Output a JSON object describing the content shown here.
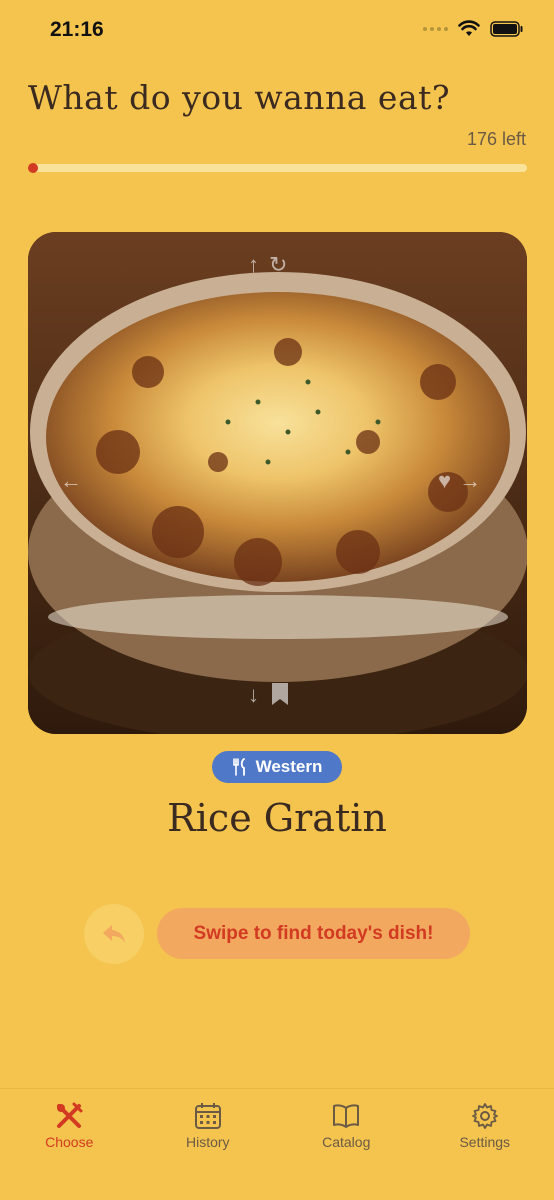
{
  "status_bar": {
    "time": "21:16"
  },
  "header": {
    "title": "What do you wanna eat?",
    "remaining": "176 left",
    "progress": 0.01
  },
  "card": {
    "dish_image_alt": "Rice Gratin",
    "hint_icons": [
      "arrow-up-icon",
      "refresh-icon",
      "arrow-left-icon",
      "heart-icon",
      "arrow-right-icon",
      "arrow-down-icon",
      "bookmark-icon"
    ]
  },
  "dish": {
    "cuisine_tag": "Western",
    "name": "Rice Gratin"
  },
  "actions": {
    "cta_label": "Swipe to find today's dish!"
  },
  "tab_bar": {
    "tabs": [
      {
        "label": "Choose",
        "icon": "utensils-cross-icon",
        "active": true
      },
      {
        "label": "History",
        "icon": "calendar-icon",
        "active": false
      },
      {
        "label": "Catalog",
        "icon": "book-icon",
        "active": false
      },
      {
        "label": "Settings",
        "icon": "gear-icon",
        "active": false
      }
    ]
  },
  "colors": {
    "background": "#f4c44f",
    "accent": "#d23a22",
    "tag": "#4f78c8",
    "cta_bg": "#f2a85f"
  }
}
